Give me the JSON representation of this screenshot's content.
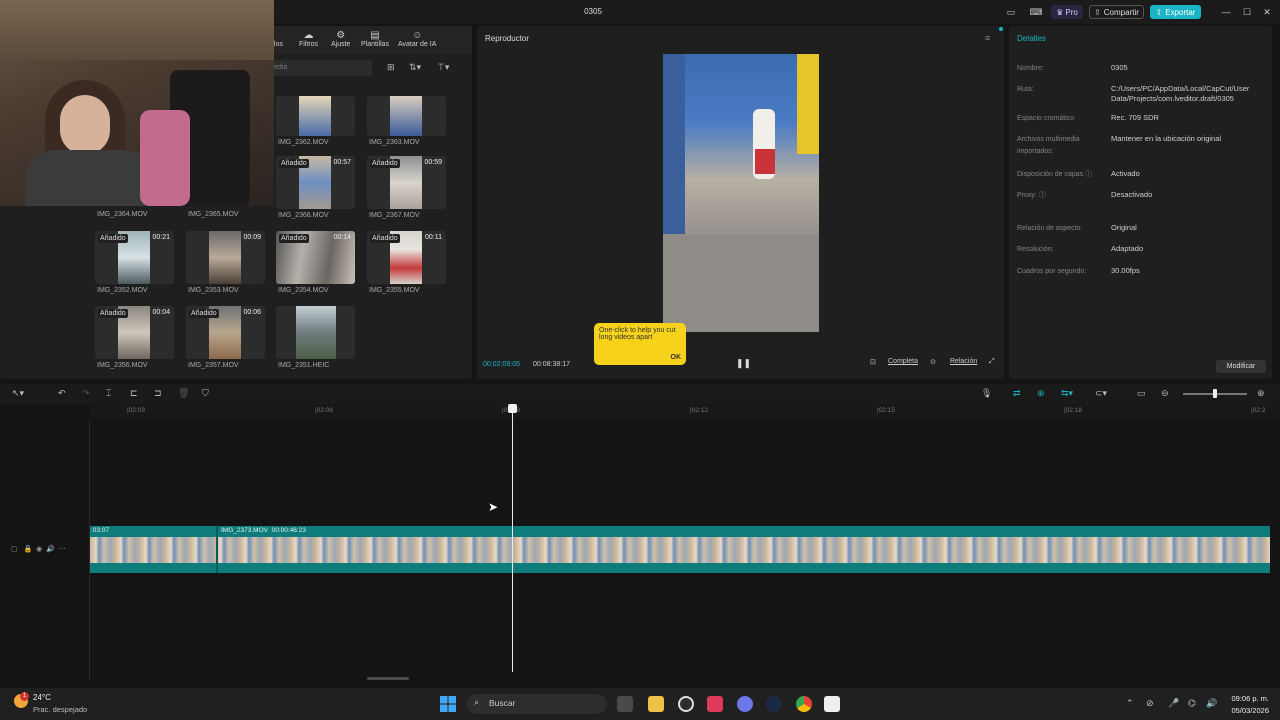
{
  "window": {
    "title": "0305",
    "pro": "Pro",
    "share": "Compartir",
    "export": "Exportar"
  },
  "media_toolbar": {
    "tabs": [
      "ulos",
      "Filtros",
      "Ajuste",
      "Plantillas",
      "Avatar de IA"
    ],
    "search_placeholder": "edia"
  },
  "media_items": [
    {
      "name": "IMG_2362.MOV",
      "added": "",
      "duration": ""
    },
    {
      "name": "IMG_2363.MOV",
      "added": "",
      "duration": ""
    },
    {
      "name": "IMG_2364.MOV",
      "added": "",
      "duration": ""
    },
    {
      "name": "IMG_2365.MOV",
      "added": "",
      "duration": ""
    },
    {
      "name": "IMG_2366.MOV",
      "added": "Añadido",
      "duration": "00:57"
    },
    {
      "name": "IMG_2367.MOV",
      "added": "Añadido",
      "duration": "00:59"
    },
    {
      "name": "IMG_2352.MOV",
      "added": "Añadido",
      "duration": "00:21"
    },
    {
      "name": "IMG_2353.MOV",
      "added": "",
      "duration": "00:09"
    },
    {
      "name": "IMG_2354.MOV",
      "added": "Añadido",
      "duration": "00:14"
    },
    {
      "name": "IMG_2355.MOV",
      "added": "Añadido",
      "duration": "00:11"
    },
    {
      "name": "IMG_2356.MOV",
      "added": "Añadido",
      "duration": "00:04"
    },
    {
      "name": "IMG_2357.MOV",
      "added": "Añadido",
      "duration": "00:06"
    },
    {
      "name": "IMG_2351.HEIC",
      "added": "",
      "duration": ""
    }
  ],
  "player": {
    "title": "Reproductor",
    "current_time": "00:02:09:05",
    "total_time": "00:08:38:17",
    "full_label": "Completa",
    "ratio_label": "Relación",
    "tooltip_text": "One-click to help you cut long videos apart",
    "tooltip_ok": "OK"
  },
  "details": {
    "title": "Detalles",
    "rows": [
      {
        "label": "Nombre:",
        "value": "0305"
      },
      {
        "label": "Ruta:",
        "value": "C:/Users/PC/AppData/Local/CapCut/User Data/Projects/com.lveditor.draft/0305"
      },
      {
        "label": "Espacio cromático",
        "value": "Rec. 709 SDR"
      },
      {
        "label": "Archivos multimedia importados:",
        "value": "Mantener en la ubicación original"
      },
      {
        "label": "Disposición de capas ⓘ",
        "value": "Activado"
      },
      {
        "label": "Proxy: ⓘ",
        "value": "Desactivado"
      },
      {
        "label": "Relación de aspecto:",
        "value": "Original"
      },
      {
        "label": "Resolución:",
        "value": "Adaptado"
      },
      {
        "label": "Cuadros por segundo:",
        "value": "30.00fps"
      }
    ],
    "modify": "Modificar"
  },
  "timeline": {
    "ticks": [
      "|02:03",
      "|02:06",
      "|02:09",
      "|02:12",
      "|02:15",
      "|02:18",
      "|02:2"
    ],
    "clip_start": ":03:07",
    "clip_name": "IMG_2373.MOV",
    "clip_duration": "00:00:46:23"
  },
  "taskbar": {
    "temp": "24°C",
    "weather": "Prac. despejado",
    "notif_count": "1",
    "search": "Buscar",
    "time": "09:06 p. m.",
    "date": "05/03/2026"
  }
}
